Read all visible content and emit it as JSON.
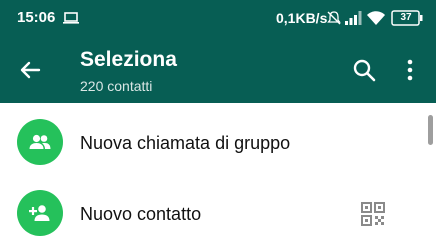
{
  "status_bar": {
    "time": "15:06",
    "network_speed": "0,1KB/s",
    "battery_level": "37",
    "icons": [
      "laptop-icon",
      "mute-icon",
      "signal-icon",
      "wifi-icon",
      "battery-icon"
    ]
  },
  "app_bar": {
    "title": "Seleziona",
    "subtitle": "220 contatti",
    "icons": [
      "back-arrow-icon",
      "search-icon",
      "more-vert-icon"
    ]
  },
  "list": {
    "items": [
      {
        "label": "Nuova chiamata di gruppo",
        "icon": "group-icon"
      },
      {
        "label": "Nuovo contatto",
        "icon": "person-add-icon",
        "trailing_icon": "qr-code-icon"
      }
    ]
  },
  "colors": {
    "header": "#075e54",
    "avatar": "#25c15b",
    "qr_icon": "#8a8a8a",
    "text": "#111111"
  }
}
